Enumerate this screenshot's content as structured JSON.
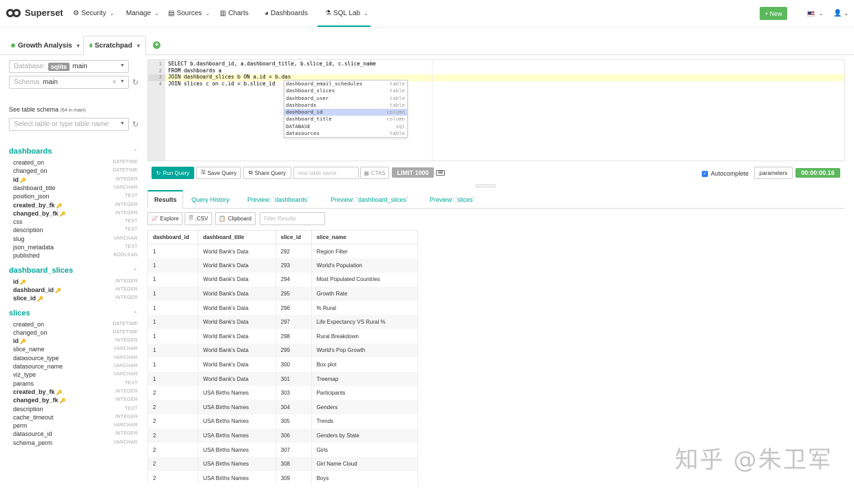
{
  "navbar": {
    "brand": "Superset",
    "items": [
      {
        "label": "Security",
        "icon": "gears-icon"
      },
      {
        "label": "Manage"
      },
      {
        "label": "Sources",
        "icon": "database-icon"
      },
      {
        "label": "Charts",
        "icon": "bar-chart-icon"
      },
      {
        "label": "Dashboards",
        "icon": "dashboard-icon"
      },
      {
        "label": "SQL Lab",
        "icon": "flask-icon"
      }
    ],
    "new_label": "New",
    "accent_color": "#00a699"
  },
  "query_tabs": [
    {
      "label": "Growth Analysis"
    },
    {
      "label": "Scratchpad"
    }
  ],
  "left": {
    "database_label": "Database:",
    "database_engine": "sqlite",
    "database_value": "main",
    "schema_label": "Schema:",
    "schema_value": "main",
    "see_schema": "See table schema",
    "schema_count": "(64 in main)",
    "table_placeholder": "Select table or type table name",
    "tables": [
      {
        "name": "dashboards",
        "columns": [
          {
            "name": "created_on",
            "type": "DATETIME"
          },
          {
            "name": "changed_on",
            "type": "DATETIME"
          },
          {
            "name": "id",
            "type": "INTEGER",
            "key": true
          },
          {
            "name": "dashboard_title",
            "type": "VARCHAR"
          },
          {
            "name": "position_json",
            "type": "TEXT"
          },
          {
            "name": "created_by_fk",
            "type": "INTEGER",
            "key": true
          },
          {
            "name": "changed_by_fk",
            "type": "INTEGER",
            "key": true
          },
          {
            "name": "css",
            "type": "TEXT"
          },
          {
            "name": "description",
            "type": "TEXT"
          },
          {
            "name": "slug",
            "type": "VARCHAR"
          },
          {
            "name": "json_metadata",
            "type": "TEXT"
          },
          {
            "name": "published",
            "type": "BOOLEAN"
          }
        ]
      },
      {
        "name": "dashboard_slices",
        "columns": [
          {
            "name": "id",
            "type": "INTEGER",
            "key": true
          },
          {
            "name": "dashboard_id",
            "type": "INTEGER",
            "key": true
          },
          {
            "name": "slice_id",
            "type": "INTEGER",
            "key": true
          }
        ]
      },
      {
        "name": "slices",
        "columns": [
          {
            "name": "created_on",
            "type": "DATETIME"
          },
          {
            "name": "changed_on",
            "type": "DATETIME"
          },
          {
            "name": "id",
            "type": "INTEGER",
            "key": true
          },
          {
            "name": "slice_name",
            "type": "VARCHAR"
          },
          {
            "name": "datasource_type",
            "type": "VARCHAR"
          },
          {
            "name": "datasource_name",
            "type": "VARCHAR"
          },
          {
            "name": "viz_type",
            "type": "VARCHAR"
          },
          {
            "name": "params",
            "type": "TEXT"
          },
          {
            "name": "created_by_fk",
            "type": "INTEGER",
            "key": true
          },
          {
            "name": "changed_by_fk",
            "type": "INTEGER",
            "key": true
          },
          {
            "name": "description",
            "type": "TEXT"
          },
          {
            "name": "cache_timeout",
            "type": "INTEGER"
          },
          {
            "name": "perm",
            "type": "VARCHAR"
          },
          {
            "name": "datasource_id",
            "type": "INTEGER"
          },
          {
            "name": "schema_perm",
            "type": "VARCHAR"
          }
        ]
      }
    ]
  },
  "editor": {
    "lines": [
      "SELECT b.dashboard_id, a.dashboard_title, b.slice_id, c.slice_name",
      "FROM dashboards a",
      "JOIN dashboard_slices b ON a.id = b.das",
      "JOIN slices c on c.id = b.slice_id"
    ],
    "autocomplete": [
      {
        "value": "dashboard_email_schedules",
        "meta": "table"
      },
      {
        "value": "dashboard_slices",
        "meta": "table"
      },
      {
        "value": "dashboard_user",
        "meta": "table"
      },
      {
        "value": "dashboards",
        "meta": "table"
      },
      {
        "value": "dashboard_id",
        "meta": "column",
        "selected": true
      },
      {
        "value": "dashboard_title",
        "meta": "column"
      },
      {
        "value": "DATABASE",
        "meta": "sql"
      },
      {
        "value": "datasources",
        "meta": "table"
      }
    ]
  },
  "toolbar": {
    "run": "Run Query",
    "save": "Save Query",
    "share": "Share Query",
    "table_placeholder": "new table name",
    "ctas": "CTAS",
    "limit": "LIMIT 1000",
    "autocomplete": "Autocomplete",
    "parameters": "parameters",
    "timer": "00:00:00.16"
  },
  "results": {
    "tabs": [
      "Results",
      "Query History",
      "Preview: `dashboards`",
      "Preview: `dashboard_slices`",
      "Preview: `slices`"
    ],
    "explore": "Explore",
    "csv": ".CSV",
    "clipboard": "Clipboard",
    "filter_placeholder": "Filter Results",
    "columns": [
      "dashboard_id",
      "dashboard_title",
      "slice_id",
      "slice_name"
    ],
    "rows": [
      [
        "1",
        "World Bank's Data",
        "292",
        "Region Filter"
      ],
      [
        "1",
        "World Bank's Data",
        "293",
        "World's Population"
      ],
      [
        "1",
        "World Bank's Data",
        "294",
        "Most Populated Countries"
      ],
      [
        "1",
        "World Bank's Data",
        "295",
        "Growth Rate"
      ],
      [
        "1",
        "World Bank's Data",
        "296",
        "% Rural"
      ],
      [
        "1",
        "World Bank's Data",
        "297",
        "Life Expectancy VS Rural %"
      ],
      [
        "1",
        "World Bank's Data",
        "298",
        "Rural Breakdown"
      ],
      [
        "1",
        "World Bank's Data",
        "299",
        "World's Pop Growth"
      ],
      [
        "1",
        "World Bank's Data",
        "300",
        "Box plot"
      ],
      [
        "1",
        "World Bank's Data",
        "301",
        "Treemap"
      ],
      [
        "2",
        "USA Births Names",
        "303",
        "Participants"
      ],
      [
        "2",
        "USA Births Names",
        "304",
        "Genders"
      ],
      [
        "2",
        "USA Births Names",
        "305",
        "Trends"
      ],
      [
        "2",
        "USA Births Names",
        "306",
        "Genders by State"
      ],
      [
        "2",
        "USA Births Names",
        "307",
        "Girls"
      ],
      [
        "2",
        "USA Births Names",
        "308",
        "Girl Name Cloud"
      ],
      [
        "2",
        "USA Births Names",
        "309",
        "Boys"
      ]
    ]
  },
  "watermark": "知乎 @朱卫军"
}
